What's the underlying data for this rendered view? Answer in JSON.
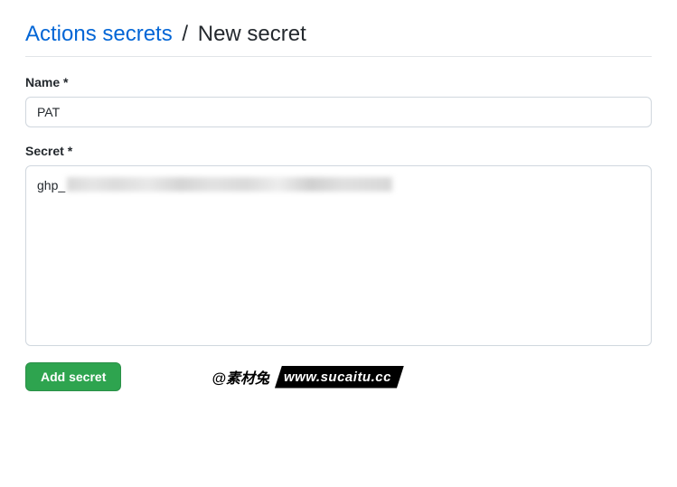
{
  "header": {
    "breadcrumb_link": "Actions secrets",
    "separator": "/",
    "current": "New secret"
  },
  "form": {
    "name_label": "Name *",
    "name_value": "PAT",
    "secret_label": "Secret *",
    "secret_prefix": "ghp_",
    "submit_label": "Add secret"
  },
  "watermark": {
    "left": "@素材兔",
    "right": "www.sucaitu.cc"
  }
}
